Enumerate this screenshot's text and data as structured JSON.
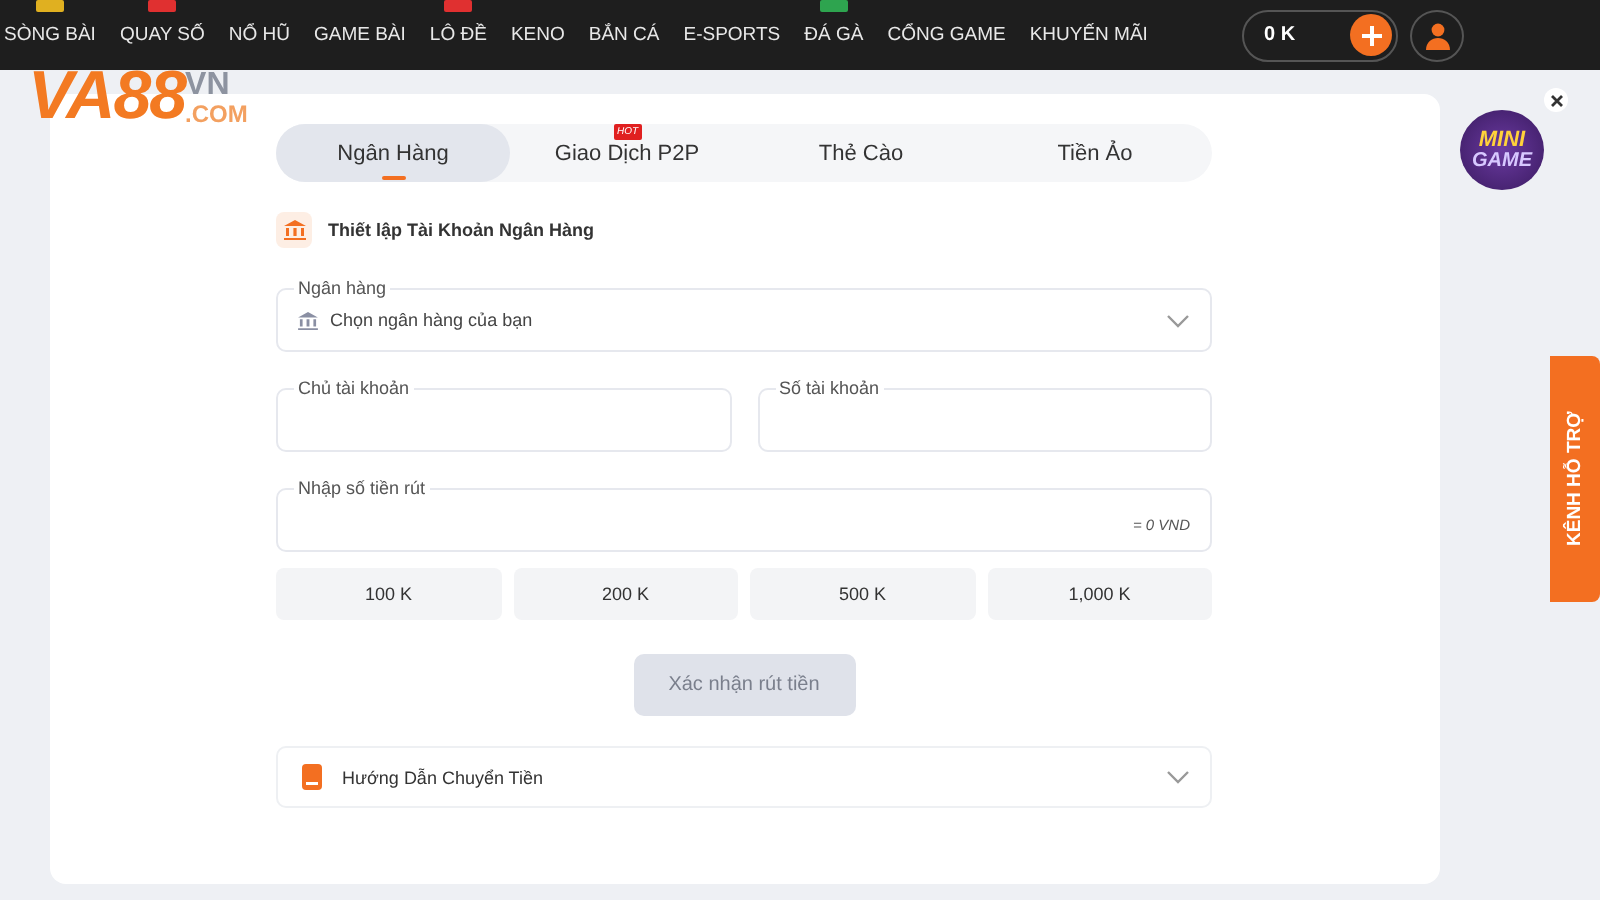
{
  "nav": {
    "items": [
      {
        "label": "SÒNG BÀI",
        "color": "#e0b020"
      },
      {
        "label": "QUAY SỐ",
        "color": "#e03030"
      },
      {
        "label": "NỔ HŨ"
      },
      {
        "label": "GAME BÀI"
      },
      {
        "label": "LÔ ĐỀ",
        "color": "#e03030"
      },
      {
        "label": "KENO"
      },
      {
        "label": "BẮN CÁ"
      },
      {
        "label": "E-SPORTS"
      },
      {
        "label": "ĐÁ GÀ",
        "color": "#2ea44f"
      },
      {
        "label": "CỔNG GAME"
      },
      {
        "label": "KHUYẾN MÃI"
      }
    ],
    "balance": "0 K"
  },
  "logo": {
    "name": "VA88",
    "sup": "VN",
    "sub": ".COM"
  },
  "tabs": [
    {
      "label": "Ngân Hàng",
      "selected": true
    },
    {
      "label": "Giao Dịch P2P",
      "selected": false,
      "badge": "HOT"
    },
    {
      "label": "Thẻ Cào",
      "selected": false
    },
    {
      "label": "Tiền Ảo",
      "selected": false
    }
  ],
  "section_title": "Thiết lập Tài Khoản Ngân Hàng",
  "bank_field": {
    "label": "Ngân hàng",
    "placeholder": "Chọn ngân hàng của bạn"
  },
  "holder_field": {
    "label": "Chủ tài khoản"
  },
  "account_field": {
    "label": "Số tài khoản"
  },
  "amount_field": {
    "label": "Nhập số tiền rút",
    "conversion": "= 0 VND"
  },
  "quick_amounts": [
    "100 K",
    "200 K",
    "500 K",
    "1,000 K"
  ],
  "submit": {
    "label": "Xác nhận rút tiền",
    "disabled": true
  },
  "guide": {
    "label": "Hướng Dẫn Chuyển Tiền",
    "expanded": false
  },
  "mini_game": {
    "line_1": "MINI",
    "line_2": "GAME"
  },
  "support_tab": "KÊNH HỖ TRỢ"
}
